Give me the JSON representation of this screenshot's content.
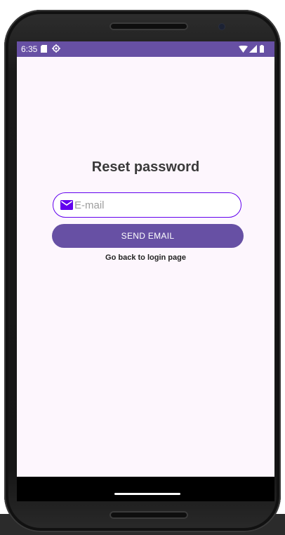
{
  "statusbar": {
    "time": "6:35",
    "left_icons": [
      "sd-card-icon",
      "gps-icon"
    ],
    "right_icons": [
      "wifi-icon",
      "signal-icon",
      "battery-icon"
    ]
  },
  "screen": {
    "title": "Reset password",
    "email_input": {
      "placeholder": "E-mail",
      "value": "",
      "icon": "mail-icon"
    },
    "send_button_label": "SEND EMAIL",
    "back_link_label": "Go back to login page"
  },
  "colors": {
    "accent": "#6750a4",
    "input_border": "#6200ee",
    "background": "#fdf6fd"
  }
}
